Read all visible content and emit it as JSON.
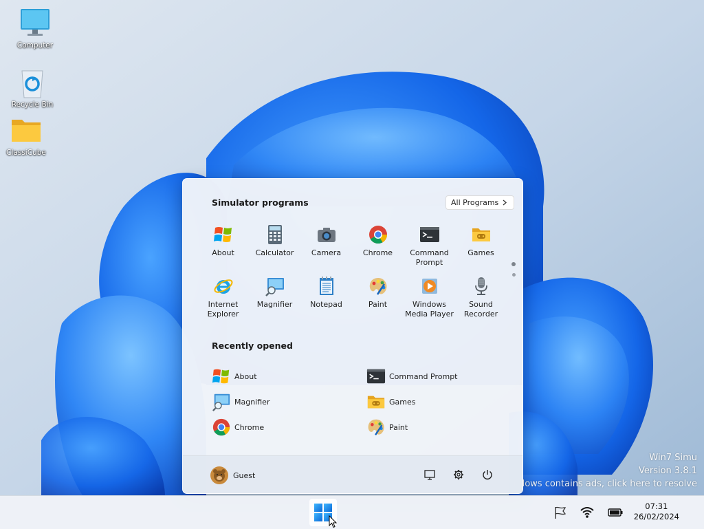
{
  "desktop": {
    "icons": [
      {
        "label": "Computer",
        "icon": "computer-icon"
      },
      {
        "label": "Recycle Bin",
        "icon": "recycle-bin-icon"
      },
      {
        "label": "ClassiCube",
        "icon": "folder-icon"
      }
    ],
    "watermark": {
      "line1": "Win7 Simu",
      "line2": "Version 3.8.1",
      "line3": "Windows contains ads, click here to resolve"
    }
  },
  "start_menu": {
    "programs_title": "Simulator programs",
    "all_programs_label": "All Programs",
    "programs": [
      {
        "label": "About",
        "icon": "windows-flag-icon"
      },
      {
        "label": "Calculator",
        "icon": "calculator-icon"
      },
      {
        "label": "Camera",
        "icon": "camera-icon"
      },
      {
        "label": "Chrome",
        "icon": "chrome-icon"
      },
      {
        "label": "Command Prompt",
        "icon": "terminal-icon"
      },
      {
        "label": "Games",
        "icon": "games-folder-icon"
      },
      {
        "label": "Internet Explorer",
        "icon": "internet-explorer-icon"
      },
      {
        "label": "Magnifier",
        "icon": "magnifier-icon"
      },
      {
        "label": "Notepad",
        "icon": "notepad-icon"
      },
      {
        "label": "Paint",
        "icon": "paint-palette-icon"
      },
      {
        "label": "Windows Media Player",
        "icon": "media-player-icon"
      },
      {
        "label": "Sound Recorder",
        "icon": "microphone-icon"
      }
    ],
    "recent_title": "Recently opened",
    "recent": [
      {
        "label": "About",
        "icon": "windows-flag-icon"
      },
      {
        "label": "Command Prompt",
        "icon": "terminal-icon"
      },
      {
        "label": "Magnifier",
        "icon": "magnifier-icon"
      },
      {
        "label": "Games",
        "icon": "games-folder-icon"
      },
      {
        "label": "Chrome",
        "icon": "chrome-icon"
      },
      {
        "label": "Paint",
        "icon": "paint-palette-icon"
      }
    ],
    "user_name": "Guest"
  },
  "taskbar": {
    "time": "07:31",
    "date": "26/02/2024"
  },
  "colors": {
    "accent": "#0a68d6",
    "wallpaper_bloom": "#1565e6"
  }
}
